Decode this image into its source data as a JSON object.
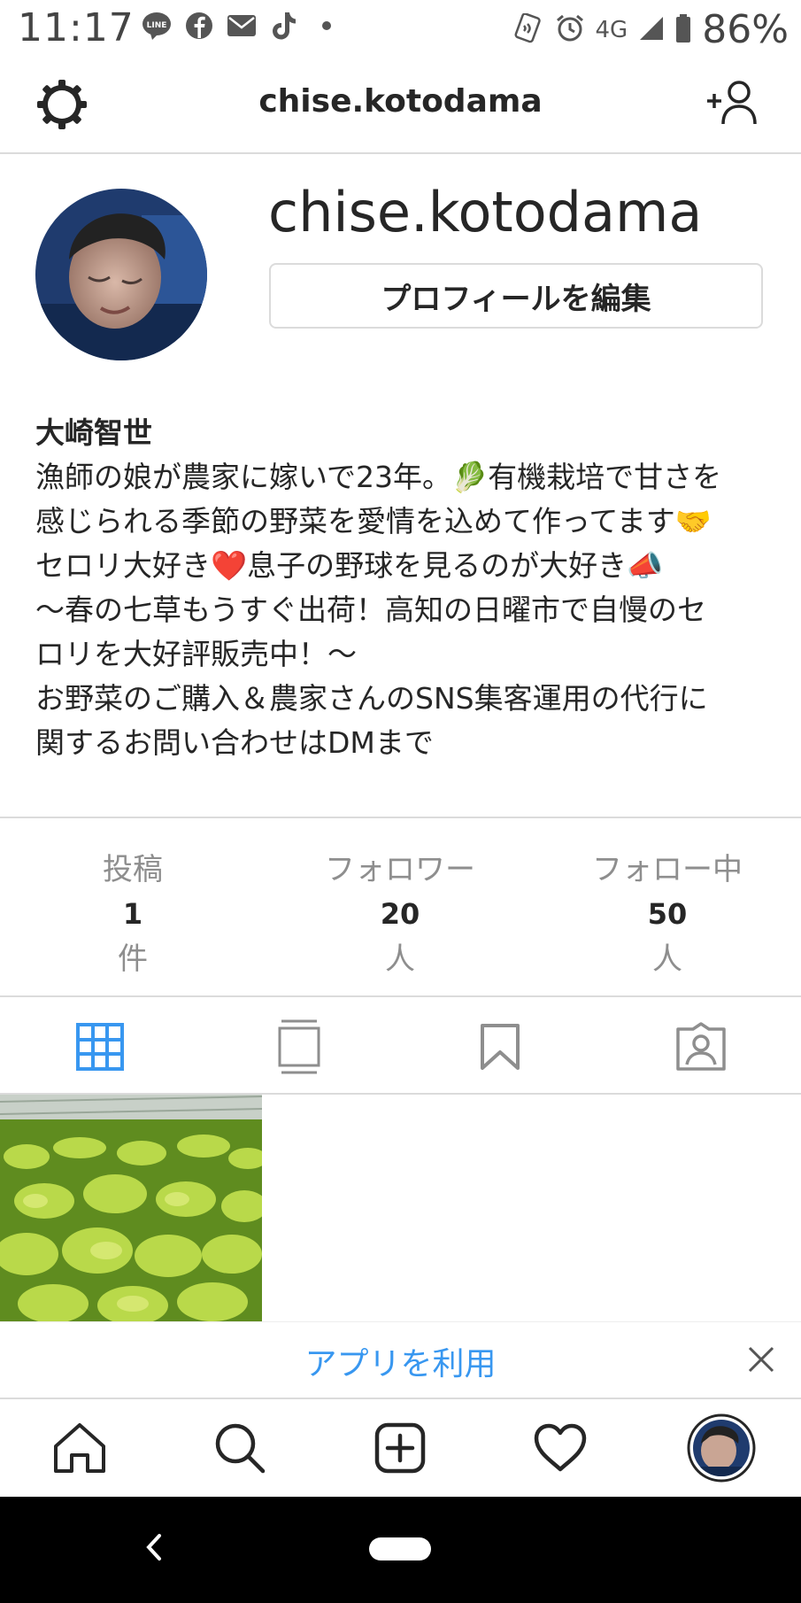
{
  "status_bar": {
    "time": "11:17",
    "network": "4G",
    "battery": "86%",
    "notification_icons": [
      "line-icon",
      "facebook-icon",
      "mail-icon",
      "tiktok-icon",
      "dot-icon"
    ]
  },
  "header": {
    "username": "chise.kotodama"
  },
  "profile": {
    "username": "chise.kotodama",
    "edit_button": "プロフィールを編集",
    "name": "大崎智世",
    "bio_lines": [
      "漁師の娘が農家に嫁いで23年。🥬有機栽培で甘さを",
      "感じられる季節の野菜を愛情を込めて作ってます🤝",
      "セロリ大好き❤️息子の野球を見るのが大好き📣",
      "〜春の七草もうすぐ出荷！高知の日曜市で自慢のセ",
      "ロリを大好評販売中！〜",
      "お野菜のご購入＆農家さんのSNS集客運用の代行に",
      "関するお問い合わせはDMまで"
    ]
  },
  "stats": {
    "posts": {
      "label": "投稿",
      "count": "1",
      "unit": "件"
    },
    "followers": {
      "label": "フォロワー",
      "count": "20",
      "unit": "人"
    },
    "following": {
      "label": "フォロー中",
      "count": "50",
      "unit": "人"
    }
  },
  "tabs": [
    "grid-icon",
    "feed-icon",
    "saved-icon",
    "tagged-icon"
  ],
  "banner": {
    "text": "アプリを利用"
  },
  "colors": {
    "accent": "#3897f0",
    "text": "#262626",
    "muted": "#8e8e8e",
    "divider": "#dbdbdb"
  }
}
